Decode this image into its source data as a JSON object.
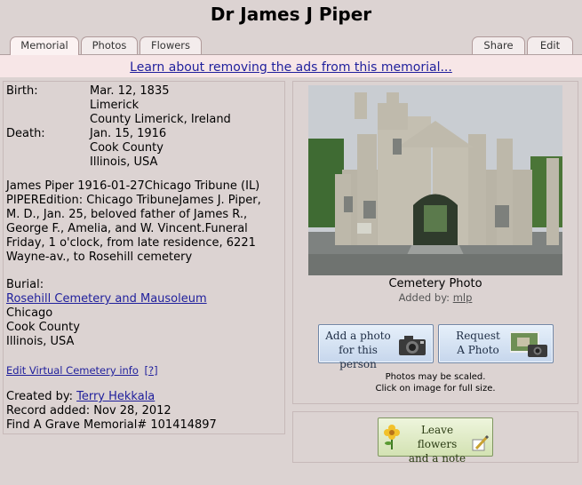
{
  "page": {
    "title": "Dr James J Piper"
  },
  "tabs": {
    "memorial": "Memorial",
    "photos": "Photos",
    "flowers": "Flowers",
    "share": "Share",
    "edit": "Edit"
  },
  "ad": {
    "link": "Learn about removing the ads from this memorial..."
  },
  "memorial": {
    "birth_label": "Birth:",
    "birth_date": "Mar. 12, 1835",
    "birth_place1": "Limerick",
    "birth_place2": "County Limerick, Ireland",
    "death_label": "Death:",
    "death_date": "Jan. 15, 1916",
    "death_place1": "Cook County",
    "death_place2": "Illinois, USA",
    "obituary_lines": [
      "James Piper 1916-01-27Chicago Tribune (IL)",
      "PIPEREdition: Chicago TribuneJames J. Piper,",
      "M. D., Jan. 25, beloved father of James R.,",
      "George F., Amelia, and W. Vincent.Funeral",
      "Friday, 1 o'clock, from late residence, 6221",
      "Wayne-av., to Rosehill cemetery"
    ],
    "burial_label": "Burial:",
    "cemetery": "Rosehill Cemetery and Mausoleum",
    "burial_city": "Chicago",
    "burial_county": "Cook County",
    "burial_state": "Illinois, USA",
    "edit_vc": "Edit Virtual Cemetery info",
    "help": "[?]",
    "created_label": "Created by:",
    "created_by": "Terry Hekkala",
    "record_added": "Record added: Nov 28, 2012",
    "memorial_id": "Find A Grave Memorial# 101414897"
  },
  "photo_panel": {
    "caption": "Cemetery Photo",
    "added_label": "Added by:",
    "added_by": "mlp",
    "add_photo_line1": "Add a photo",
    "add_photo_line2": "for this person",
    "request_line1": "Request",
    "request_line2": "A Photo",
    "scaled_note": "Photos may be scaled.",
    "click_note": "Click on image for full size.",
    "flowers_line1": "Leave flowers",
    "flowers_line2": "and a note"
  },
  "icons": {
    "camera": "camera-icon",
    "flower": "flower-icon",
    "pencil": "pencil-icon"
  },
  "colors": {
    "background": "#dcd3d2",
    "ad_bar": "#f7e6e7",
    "link": "#1f1f9c"
  }
}
